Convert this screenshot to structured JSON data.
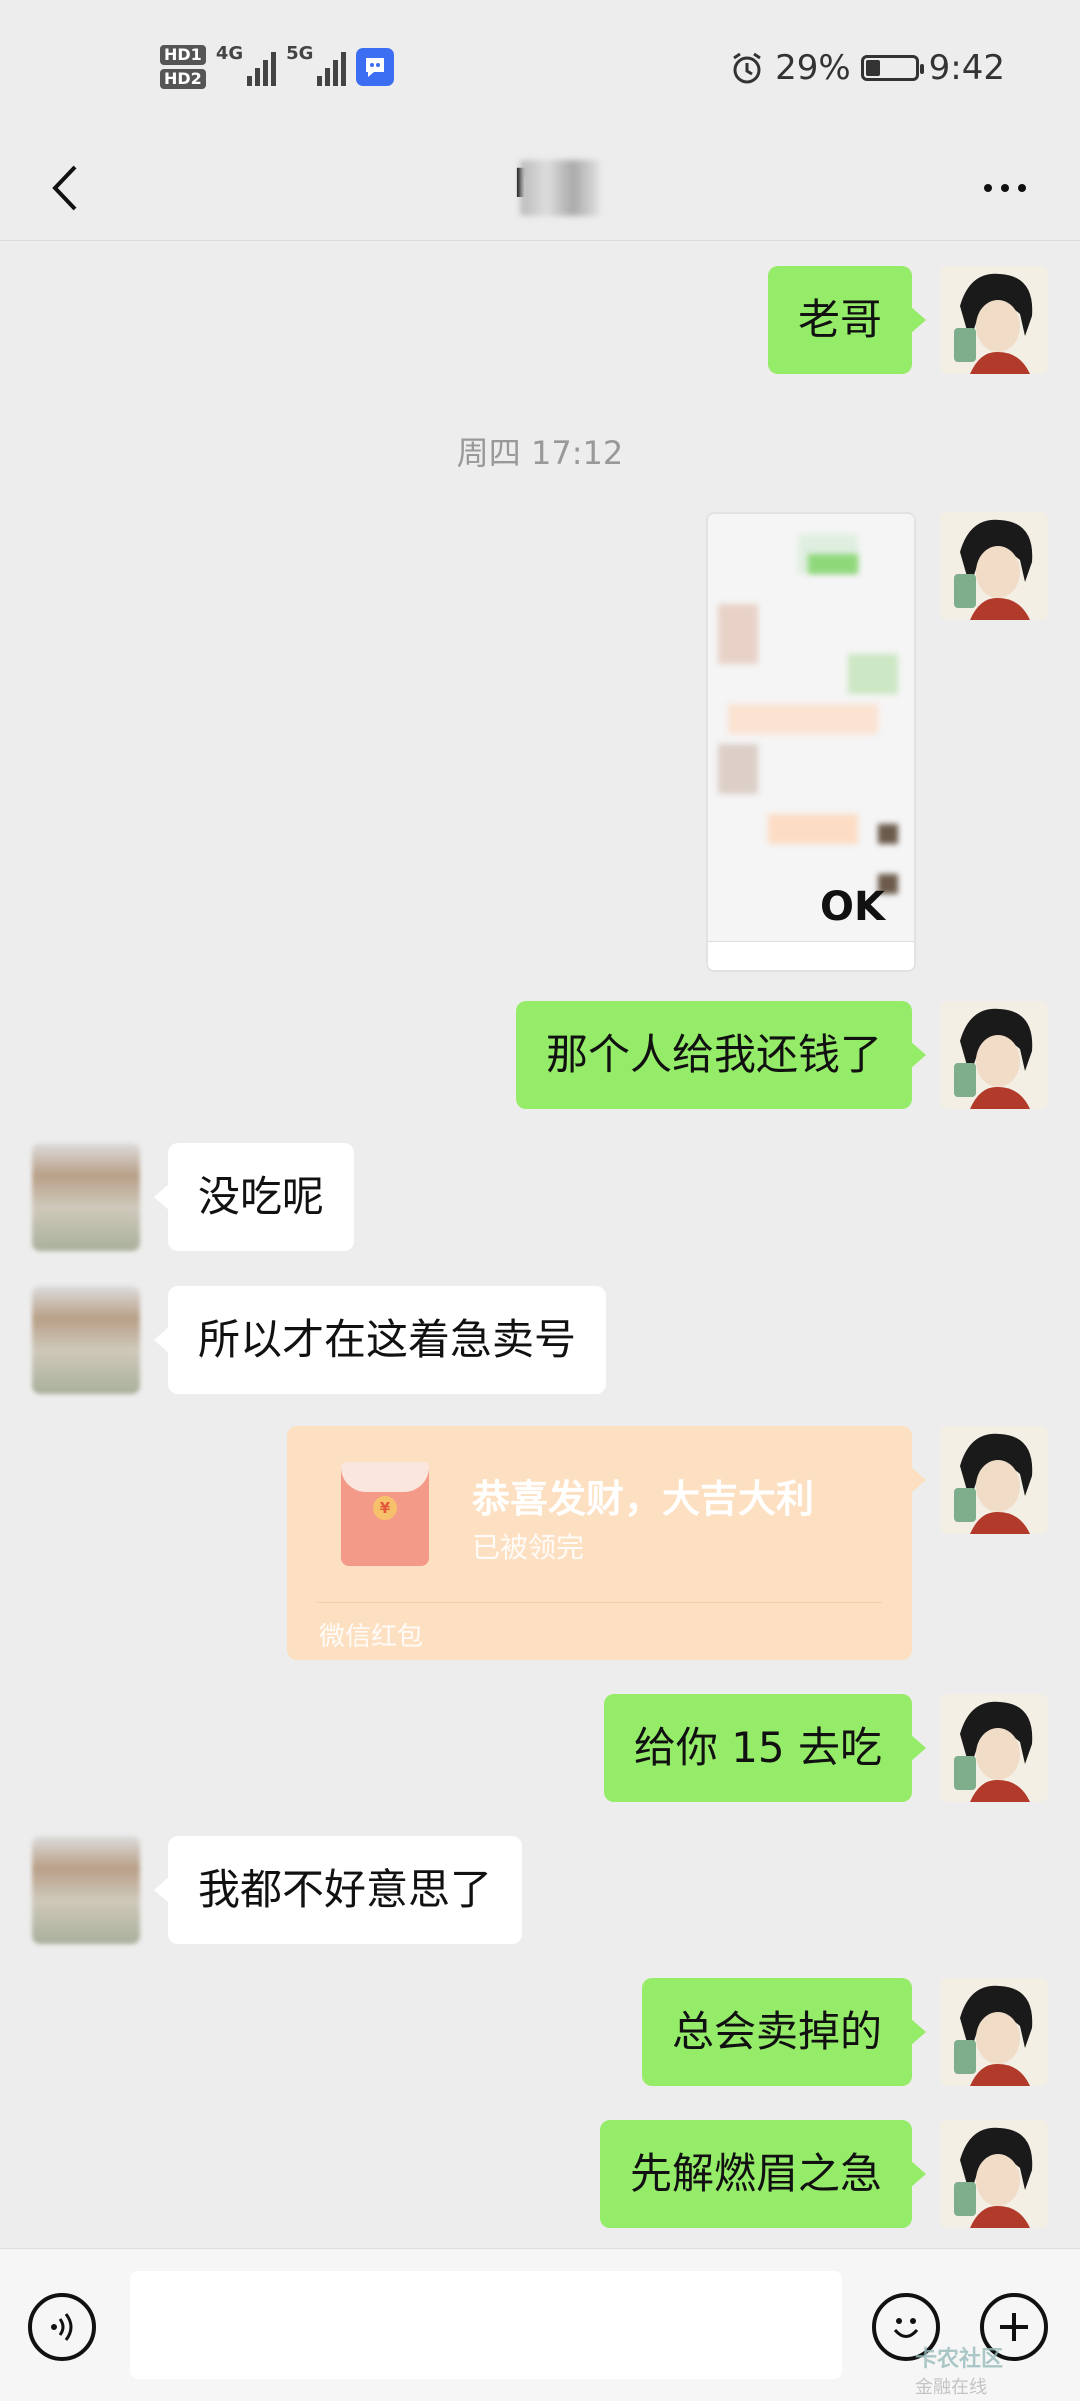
{
  "status_bar": {
    "hd1": "HD1",
    "hd2": "HD2",
    "net1": "4G",
    "net2": "5G",
    "battery_percent": "29%",
    "battery_level": 0.29,
    "time": "9:42"
  },
  "header": {
    "title": "Mi"
  },
  "messages": {
    "m1": "老哥",
    "timestamp": "周四 17:12",
    "image_ok_text": "OK",
    "m2": "那个人给我还钱了",
    "m3": "没吃呢",
    "m4": "所以才在这着急卖号",
    "red_packet": {
      "title": "恭喜发财，大吉大利",
      "status": "已被领完",
      "label": "微信红包",
      "coin": "¥"
    },
    "m5": "给你 15 去吃",
    "m6": "我都不好意思了",
    "m7": "总会卖掉的",
    "m8": "先解燃眉之急"
  },
  "input": {
    "value": "",
    "watermark_title": "卡农社区",
    "watermark_sub": "金融在线"
  },
  "colors": {
    "bg": "#EDEDED",
    "self_bubble": "#95EC69",
    "other_bubble": "#FFFFFF",
    "red_packet": "#FDE0C1"
  }
}
